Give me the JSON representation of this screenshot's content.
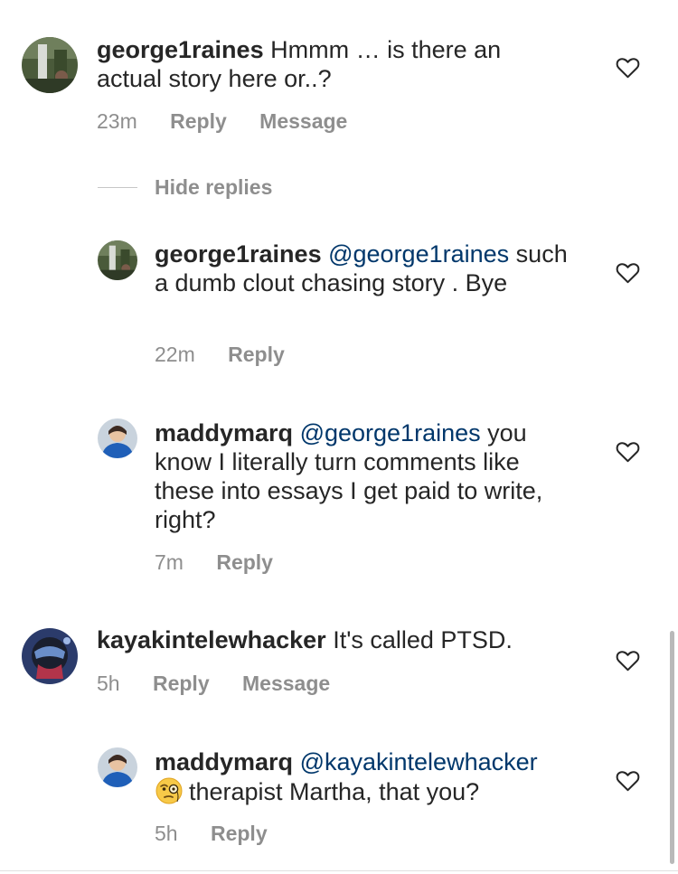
{
  "comments": [
    {
      "username": "george1raines",
      "text": "Hmmm … is there an actual story here or..?",
      "time": "23m",
      "reply_label": "Reply",
      "message_label": "Message"
    },
    {
      "username": "kayakintelewhacker",
      "text": "It's called PTSD.",
      "time": "5h",
      "reply_label": "Reply",
      "message_label": "Message"
    }
  ],
  "hide_replies_label": "Hide replies",
  "replies": [
    {
      "username": "george1raines",
      "mention": "@george1raines",
      "text": "such a dumb clout chasing story . Bye",
      "time": "22m",
      "reply_label": "Reply"
    },
    {
      "username": "maddymarq",
      "mention": "@george1raines",
      "text": "you know I literally turn comments like these into essays I get paid to write, right?",
      "time": "7m",
      "reply_label": "Reply"
    },
    {
      "username": "maddymarq",
      "mention": "@kayakintelewhacker",
      "emoji": "face-with-monocle-emoji",
      "text": "therapist Martha, that you?",
      "time": "5h",
      "reply_label": "Reply"
    }
  ],
  "icons": {
    "like": "heart-outline-icon"
  },
  "colors": {
    "text": "#262626",
    "secondary": "#8e8e8e",
    "mention": "#00376b"
  }
}
